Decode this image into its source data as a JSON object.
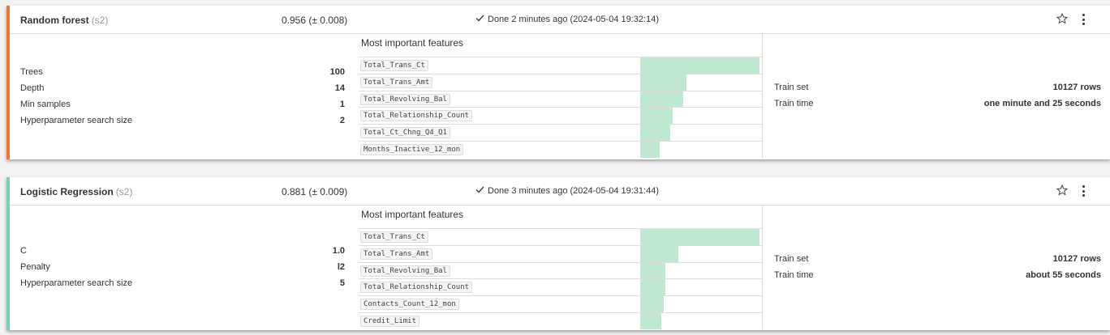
{
  "models": [
    {
      "name": "Random forest",
      "session": "(s2)",
      "score": "0.956 (± 0.008)",
      "status": "Done 2 minutes ago (2024-05-04 19:32:14)",
      "params": [
        {
          "key": "Trees",
          "value": "100"
        },
        {
          "key": "Depth",
          "value": "14"
        },
        {
          "key": "Min samples",
          "value": "1"
        },
        {
          "key": "Hyperparameter search size",
          "value": "2"
        }
      ],
      "features_title": "Most important features",
      "features": [
        {
          "name": "Total_Trans_Ct",
          "importance": 1.0
        },
        {
          "name": "Total_Trans_Amt",
          "importance": 0.39
        },
        {
          "name": "Total_Revolving_Bal",
          "importance": 0.36
        },
        {
          "name": "Total_Relationship_Count",
          "importance": 0.27
        },
        {
          "name": "Total_Ct_Chng_Q4_Q1",
          "importance": 0.25
        },
        {
          "name": "Months_Inactive_12_mon",
          "importance": 0.16
        }
      ],
      "train": [
        {
          "key": "Train set",
          "value": "10127 rows"
        },
        {
          "key": "Train time",
          "value": "one minute and 25 seconds"
        }
      ],
      "accent": "#e8773a"
    },
    {
      "name": "Logistic Regression",
      "session": "(s2)",
      "score": "0.881 (± 0.009)",
      "status": "Done 3 minutes ago (2024-05-04 19:31:44)",
      "params": [
        {
          "key": "C",
          "value": "1.0"
        },
        {
          "key": "Penalty",
          "value": "l2"
        },
        {
          "key": "Hyperparameter search size",
          "value": "5"
        }
      ],
      "features_title": "Most important features",
      "features": [
        {
          "name": "Total_Trans_Ct",
          "importance": 1.0
        },
        {
          "name": "Total_Trans_Amt",
          "importance": 0.32
        },
        {
          "name": "Total_Revolving_Bal",
          "importance": 0.21
        },
        {
          "name": "Total_Relationship_Count",
          "importance": 0.21
        },
        {
          "name": "Contacts_Count_12_mon",
          "importance": 0.2
        },
        {
          "name": "Credit_Limit",
          "importance": 0.18
        }
      ],
      "train": [
        {
          "key": "Train set",
          "value": "10127 rows"
        },
        {
          "key": "Train time",
          "value": "about 55 seconds"
        }
      ],
      "accent": "#7fd1ae"
    }
  ],
  "icons": {
    "status": "check-icon",
    "favorite": "star-icon",
    "menu": "kebab-menu-icon"
  }
}
